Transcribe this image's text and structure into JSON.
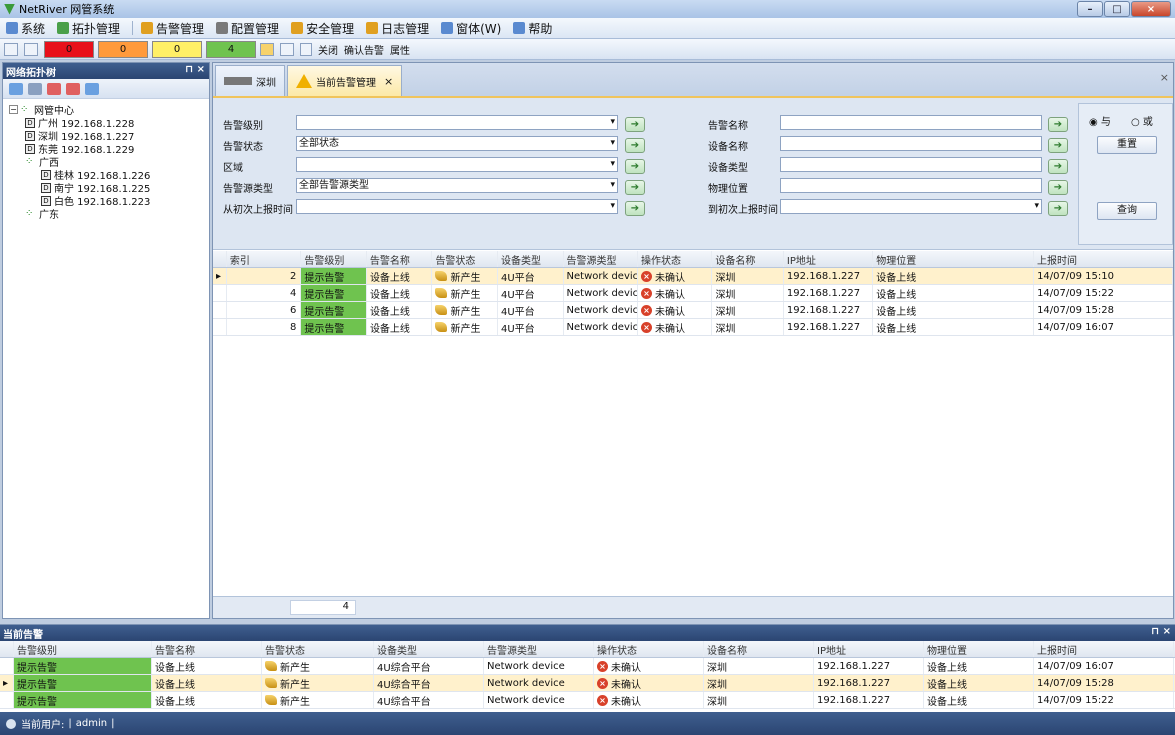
{
  "window": {
    "title": "NetRiver 网管系统"
  },
  "menu": [
    "系统",
    "拓扑管理",
    "告警管理",
    "配置管理",
    "安全管理",
    "日志管理",
    "窗体(W)",
    "帮助"
  ],
  "toolbar": {
    "counters": [
      {
        "value": "0",
        "color": "#e8101a"
      },
      {
        "value": "0",
        "color": "#ff9a3c"
      },
      {
        "value": "0",
        "color": "#ffef66"
      },
      {
        "value": "4",
        "color": "#6fc34f"
      }
    ],
    "close_label": "关闭",
    "confirm_label": "确认告警",
    "props_label": "属性"
  },
  "tree_panel": {
    "title": "网络拓扑树",
    "root": "网管中心",
    "nodes": [
      {
        "label": "广州 192.168.1.228",
        "type": "dev",
        "level": 1
      },
      {
        "label": "深圳 192.168.1.227",
        "type": "dev",
        "level": 1
      },
      {
        "label": "东莞 192.168.1.229",
        "type": "dev",
        "level": 1
      },
      {
        "label": "广西",
        "type": "grp",
        "level": 1
      },
      {
        "label": "桂林 192.168.1.226",
        "type": "dev",
        "level": 2
      },
      {
        "label": "南宁 192.168.1.225",
        "type": "dev",
        "level": 2
      },
      {
        "label": "白色 192.168.1.223",
        "type": "dev",
        "level": 2
      },
      {
        "label": "广东",
        "type": "grp",
        "level": 1
      }
    ]
  },
  "tabs": [
    {
      "label": "深圳",
      "active": false
    },
    {
      "label": "当前告警管理",
      "active": true
    }
  ],
  "filter": {
    "left": [
      {
        "label": "告警级别",
        "value": ""
      },
      {
        "label": "告警状态",
        "value": "全部状态"
      },
      {
        "label": "区域",
        "value": ""
      },
      {
        "label": "告警源类型",
        "value": "全部告警源类型"
      },
      {
        "label": "从初次上报时间",
        "value": ""
      }
    ],
    "right": [
      {
        "label": "告警名称",
        "value": ""
      },
      {
        "label": "设备名称",
        "value": ""
      },
      {
        "label": "设备类型",
        "value": ""
      },
      {
        "label": "物理位置",
        "value": ""
      },
      {
        "label": "到初次上报时间",
        "value": ""
      }
    ],
    "radio_and": "与",
    "radio_or": "或",
    "reset": "重置",
    "query": "查询"
  },
  "grid": {
    "columns": [
      "索引",
      "告警级别",
      "告警名称",
      "告警状态",
      "设备类型",
      "告警源类型",
      "操作状态",
      "设备名称",
      "IP地址",
      "物理位置",
      "上报时间"
    ],
    "rows": [
      [
        "2",
        "提示告警",
        "设备上线",
        "新产生",
        "4U平台",
        "Network device",
        "未确认",
        "深圳",
        "192.168.1.227",
        "设备上线",
        "14/07/09 15:10"
      ],
      [
        "4",
        "提示告警",
        "设备上线",
        "新产生",
        "4U平台",
        "Network device",
        "未确认",
        "深圳",
        "192.168.1.227",
        "设备上线",
        "14/07/09 15:22"
      ],
      [
        "6",
        "提示告警",
        "设备上线",
        "新产生",
        "4U平台",
        "Network device",
        "未确认",
        "深圳",
        "192.168.1.227",
        "设备上线",
        "14/07/09 15:28"
      ],
      [
        "8",
        "提示告警",
        "设备上线",
        "新产生",
        "4U平台",
        "Network device",
        "未确认",
        "深圳",
        "192.168.1.227",
        "设备上线",
        "14/07/09 16:07"
      ]
    ],
    "count": "4"
  },
  "bottom_panel": {
    "title": "当前告警",
    "columns": [
      "告警级别",
      "告警名称",
      "告警状态",
      "设备类型",
      "告警源类型",
      "操作状态",
      "设备名称",
      "IP地址",
      "物理位置",
      "上报时间"
    ],
    "rows": [
      [
        "提示告警",
        "设备上线",
        "新产生",
        "4U综合平台",
        "Network device",
        "未确认",
        "深圳",
        "192.168.1.227",
        "设备上线",
        "14/07/09 16:07"
      ],
      [
        "提示告警",
        "设备上线",
        "新产生",
        "4U综合平台",
        "Network device",
        "未确认",
        "深圳",
        "192.168.1.227",
        "设备上线",
        "14/07/09 15:28"
      ],
      [
        "提示告警",
        "设备上线",
        "新产生",
        "4U综合平台",
        "Network device",
        "未确认",
        "深圳",
        "192.168.1.227",
        "设备上线",
        "14/07/09 15:22"
      ]
    ]
  },
  "status": {
    "user_label": "当前用户:",
    "user": "admin"
  }
}
